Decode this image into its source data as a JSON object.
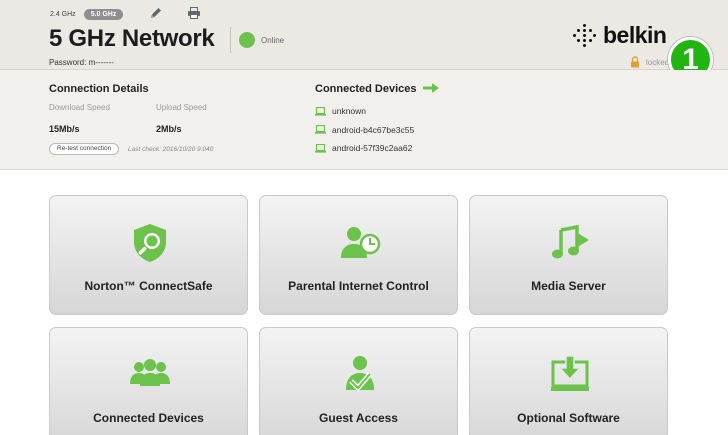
{
  "header": {
    "bands": [
      "2.4 GHz",
      "5.0 GHz"
    ],
    "network_title": "5 GHz Network",
    "status": "Online",
    "password": "Password: m-------",
    "brand": "belkin",
    "lock_status": "locked",
    "step_badge": "1"
  },
  "connection": {
    "title": "Connection Details",
    "download_label": "Download Speed",
    "upload_label": "Upload Speed",
    "download_value": "15Mb/s",
    "upload_value": "2Mb/s",
    "retest_label": "Re-test connection",
    "last_check": "Last check: 2016/10/20 9:040"
  },
  "devices": {
    "title": "Connected Devices",
    "items": [
      "unknown",
      "android-b4c67be3c55",
      "android-57f39c2aa62"
    ]
  },
  "tiles": [
    {
      "label": "Norton™ ConnectSafe",
      "icon": "norton-shield-icon"
    },
    {
      "label": "Parental Internet Control",
      "icon": "parental-control-icon"
    },
    {
      "label": "Media Server",
      "icon": "media-server-icon"
    },
    {
      "label": "Connected Devices",
      "icon": "connected-devices-icon"
    },
    {
      "label": "Guest Access",
      "icon": "guest-access-icon"
    },
    {
      "label": "Optional Software",
      "icon": "optional-software-icon"
    }
  ],
  "colors": {
    "accent_green": "#6cc24a",
    "badge_green": "#22b511",
    "header_bg": "#ece9e4"
  }
}
